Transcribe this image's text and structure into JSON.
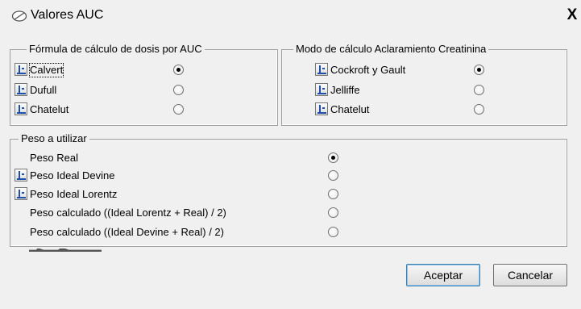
{
  "window": {
    "title": "Valores AUC",
    "close_label": "X"
  },
  "formula_group": {
    "legend": "Fórmula de cálculo de dosis por AUC",
    "options": [
      {
        "label": "Calvert",
        "selected": true
      },
      {
        "label": "Dufull",
        "selected": false
      },
      {
        "label": "Chatelut",
        "selected": false
      }
    ]
  },
  "creatinine_group": {
    "legend": "Modo de cálculo Aclaramiento Creatinina",
    "options": [
      {
        "label": "Cockroft y Gault",
        "selected": true
      },
      {
        "label": "Jelliffe",
        "selected": false
      },
      {
        "label": "Chatelut",
        "selected": false
      }
    ]
  },
  "weight_group": {
    "legend": "Peso a utilizar",
    "options": [
      {
        "label": "Peso Real",
        "selected": true
      },
      {
        "label": "Peso Ideal Devine",
        "selected": false
      },
      {
        "label": "Peso Ideal Lorentz",
        "selected": false
      },
      {
        "label": "Peso calculado ((Ideal Lorentz + Real) / 2)",
        "selected": false
      },
      {
        "label": "Peso calculado ((Ideal Devine + Real) / 2)",
        "selected": false
      }
    ]
  },
  "buttons": {
    "accept": "Aceptar",
    "cancel": "Cancelar"
  },
  "colors": {
    "accent_border": "#3c7fb1",
    "group_border": "#a0a0a0",
    "background": "#f0f0f0",
    "icon_blue": "#1f4fa8"
  }
}
